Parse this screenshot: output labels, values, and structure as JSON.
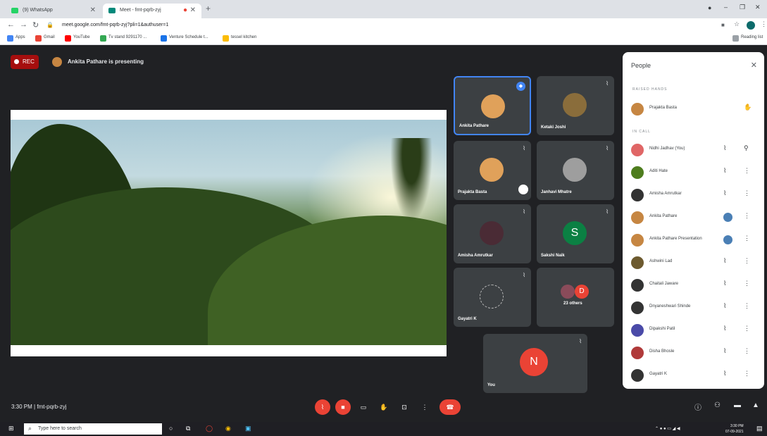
{
  "browser": {
    "tabs": [
      {
        "label": "(9) WhatsApp",
        "color": "#25d366"
      },
      {
        "label": "Meet - fmt-pqrb-zyj",
        "color": "#00897b"
      }
    ],
    "new_tab": "+",
    "url": "meet.google.com/fmt-pqrb-zyj?pli=1&authuser=1",
    "bookmarks": [
      {
        "label": "Apps",
        "color": "#4285f4"
      },
      {
        "label": "Gmail",
        "color": "#ea4335"
      },
      {
        "label": "YouTube",
        "color": "#ff0000"
      },
      {
        "label": "Tv stand 9291170 ...",
        "color": "#34a853"
      },
      {
        "label": "Venture Schedule t...",
        "color": "#1a73e8"
      },
      {
        "label": "tessel kitchen",
        "color": "#fbbc04"
      }
    ],
    "reading_list": "Reading list"
  },
  "meeting": {
    "rec_label": "REC",
    "presenter_text": "Ankita Pathare is presenting",
    "time": "3:30 PM",
    "separator": "|",
    "code": "fmt-pqrb-zyj"
  },
  "tiles": [
    {
      "name": "Ankita Pathare",
      "color": "#e0a15a"
    },
    {
      "name": "Ketaki Joshi",
      "color": "#8a6d3b"
    },
    {
      "name": "Prajakta Basta",
      "color": "#e0a15a"
    },
    {
      "name": "Janhavi Mhatre",
      "color": "#9e9e9e"
    },
    {
      "name": "Amisha Amrutkar",
      "color": "#4a2b35"
    },
    {
      "name": "Sakshi Naik",
      "letter": "S",
      "color": "#0b8043"
    },
    {
      "name": "Gayatri K",
      "color": "#3c4043"
    },
    {
      "name": "23 others",
      "letter": "D",
      "color": "#ea4335"
    },
    {
      "name": "You",
      "letter": "N",
      "color": "#ea4335"
    }
  ],
  "people": {
    "title": "People",
    "raised_hands_label": "RAISED HANDS",
    "raised": [
      {
        "name": "Prajakta Basta",
        "color": "#c68642"
      }
    ],
    "in_call_label": "IN CALL",
    "in_call": [
      {
        "name": "Nidhi Jadhav (You)",
        "color": "#e06666"
      },
      {
        "name": "Aditi Hate",
        "color": "#4e7d1e"
      },
      {
        "name": "Amisha Amrutkar",
        "color": "#333333"
      },
      {
        "name": "Ankita Pathare",
        "color": "#c68642"
      },
      {
        "name": "Ankita Pathare Presentation",
        "color": "#c68642"
      },
      {
        "name": "Ashwini Lad",
        "color": "#6d5a2f"
      },
      {
        "name": "Chaitali Jaware",
        "color": "#333333"
      },
      {
        "name": "Dnyaneshwari Shinde",
        "color": "#333333"
      },
      {
        "name": "Dipakshi Patil",
        "color": "#4a4aa8"
      },
      {
        "name": "Disha Bhosle",
        "color": "#b03a3a"
      },
      {
        "name": "Gayatri K",
        "color": "#333333"
      }
    ]
  },
  "taskbar": {
    "search_placeholder": "Type here to search",
    "time": "3:30 PM",
    "date": "07-09-2021"
  }
}
